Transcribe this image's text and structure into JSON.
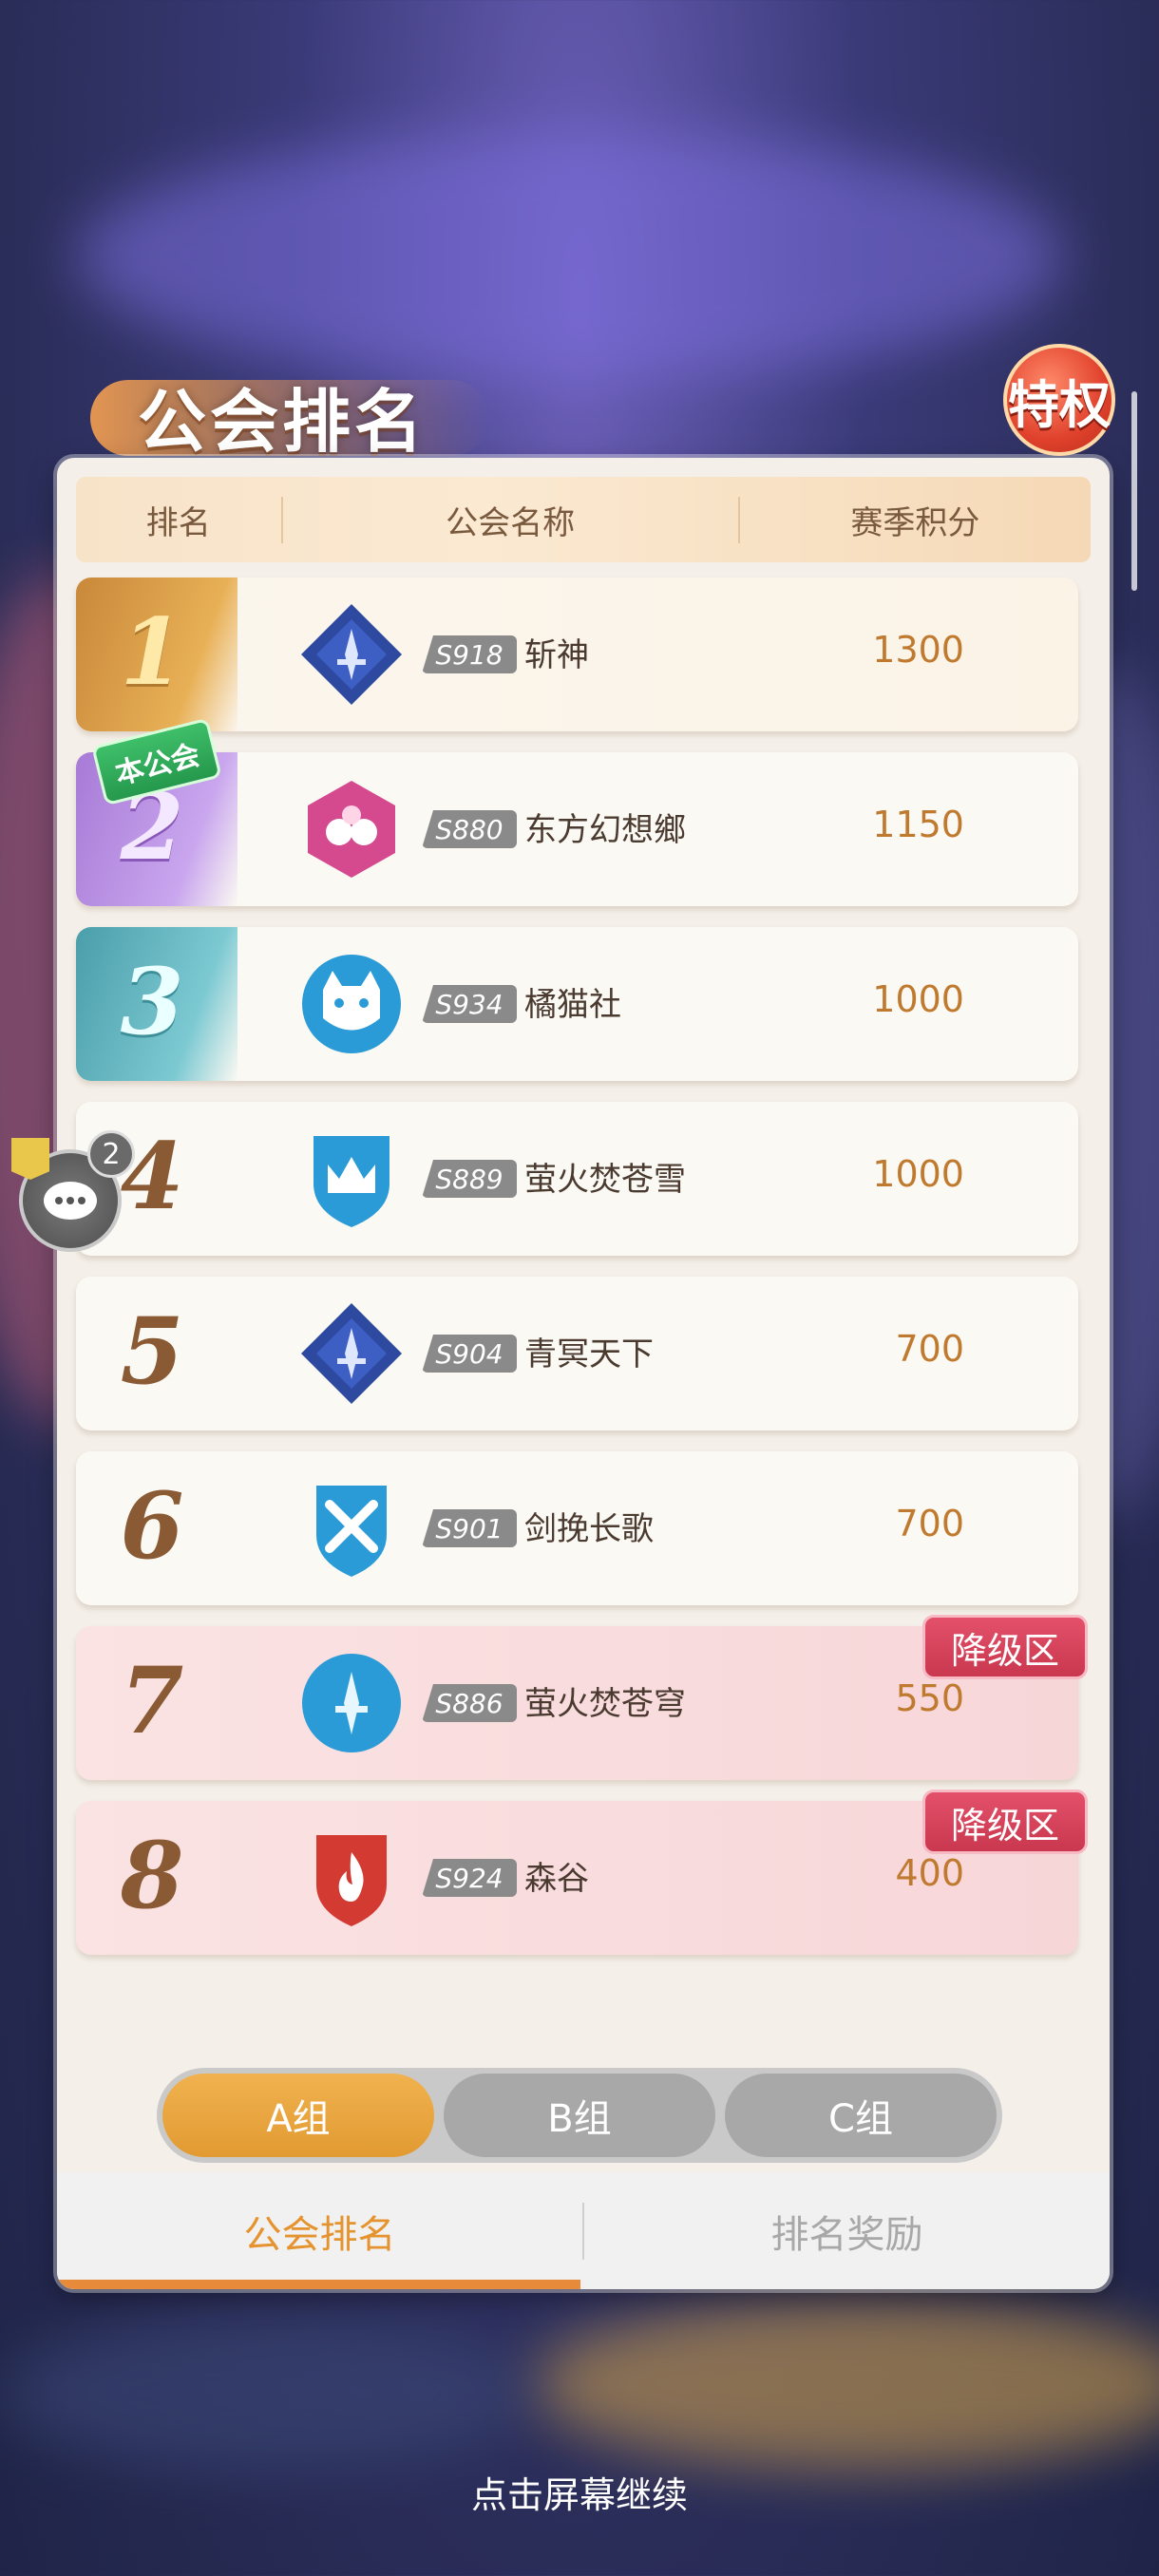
{
  "title": "公会排名",
  "privilege_badge": "特权",
  "table_header": {
    "rank": "排名",
    "name": "公会名称",
    "score": "赛季积分"
  },
  "own_guild_label": "本公会",
  "relegation_label": "降级区",
  "rows": [
    {
      "rank": "1",
      "server": "S918",
      "name": "斩神",
      "score": "1300",
      "emblem": "sword-diamond-icon"
    },
    {
      "rank": "2",
      "server": "S880",
      "name": "东方幻想鄉",
      "score": "1150",
      "emblem": "hexagon-flower-icon"
    },
    {
      "rank": "3",
      "server": "S934",
      "name": "橘猫社",
      "score": "1000",
      "emblem": "cat-icon"
    },
    {
      "rank": "4",
      "server": "S889",
      "name": "萤火焚苍雪",
      "score": "1000",
      "emblem": "crown-shield-icon"
    },
    {
      "rank": "5",
      "server": "S904",
      "name": "青冥天下",
      "score": "700",
      "emblem": "sword-diamond-icon"
    },
    {
      "rank": "6",
      "server": "S901",
      "name": "剑挽长歌",
      "score": "700",
      "emblem": "crossed-swords-shield-icon"
    },
    {
      "rank": "7",
      "server": "S886",
      "name": "萤火焚苍穹",
      "score": "550",
      "emblem": "sword-circle-icon"
    },
    {
      "rank": "8",
      "server": "S924",
      "name": "森谷",
      "score": "400",
      "emblem": "fire-shield-icon"
    }
  ],
  "group_tabs": [
    "A组",
    "B组",
    "C组"
  ],
  "bottom_tabs": [
    "公会排名",
    "排名奖励"
  ],
  "chat_badge_count": "2",
  "footer_hint": "点击屏幕继续",
  "colors": {
    "accent": "#e5932e",
    "relegation": "#d0405a",
    "own_guild": "#2fae5a"
  }
}
